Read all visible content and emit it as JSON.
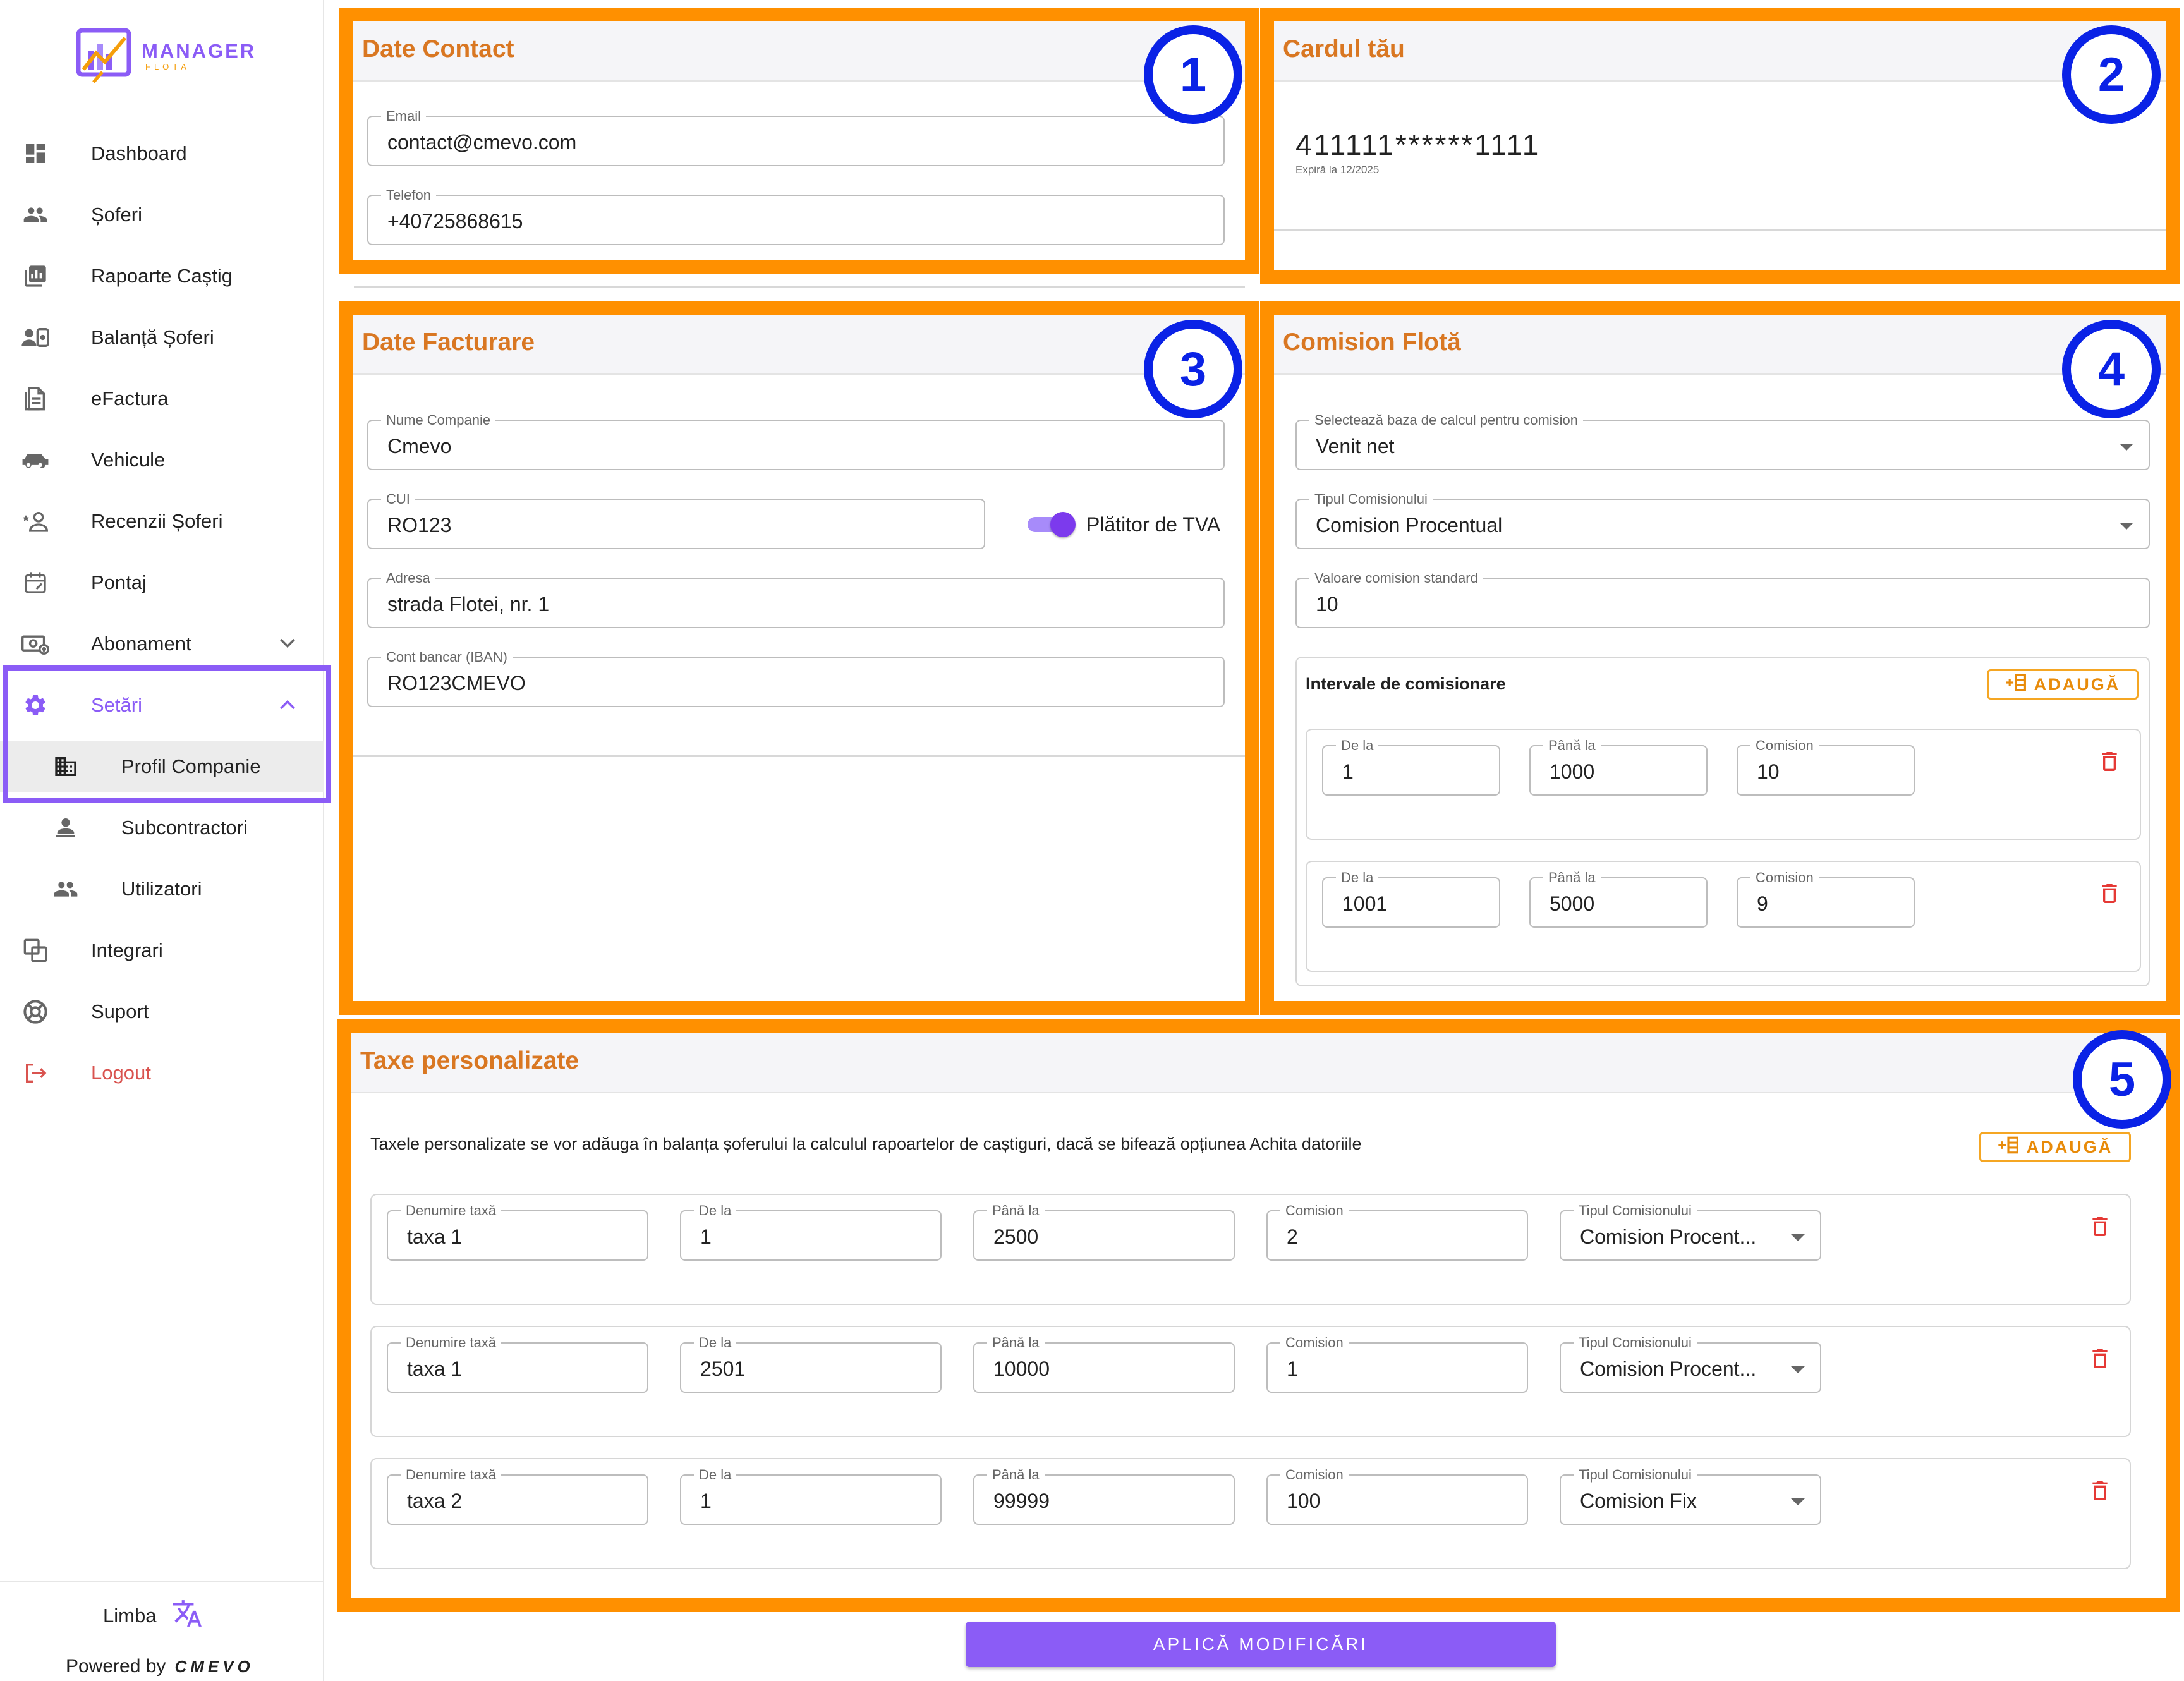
{
  "app": {
    "logo_line1": "MANAGER",
    "logo_line2": "FLOTA"
  },
  "sidebar": {
    "items": [
      {
        "label": "Dashboard",
        "icon": "dashboard-icon"
      },
      {
        "label": "Șoferi",
        "icon": "drivers-icon"
      },
      {
        "label": "Rapoarte Caștig",
        "icon": "reports-icon"
      },
      {
        "label": "Balanță Șoferi",
        "icon": "balance-icon"
      },
      {
        "label": "eFactura",
        "icon": "invoice-icon"
      },
      {
        "label": "Vehicule",
        "icon": "vehicle-icon"
      },
      {
        "label": "Recenzii Șoferi",
        "icon": "reviews-icon"
      },
      {
        "label": "Pontaj",
        "icon": "timesheet-icon"
      },
      {
        "label": "Abonament",
        "icon": "subscription-icon"
      },
      {
        "label": "Setări",
        "icon": "gear-icon"
      },
      {
        "label": "Profil Companie",
        "icon": "building-icon"
      },
      {
        "label": "Subcontractori",
        "icon": "subcontractor-icon"
      },
      {
        "label": "Utilizatori",
        "icon": "users-icon"
      },
      {
        "label": "Integrari",
        "icon": "integrations-icon"
      },
      {
        "label": "Suport",
        "icon": "support-icon"
      },
      {
        "label": "Logout",
        "icon": "logout-icon"
      }
    ],
    "language_label": "Limba",
    "powered_by": "Powered by",
    "powered_brand": "CMEVO"
  },
  "contact": {
    "title": "Date Contact",
    "badge": "1",
    "email_label": "Email",
    "email": "contact@cmevo.com",
    "phone_label": "Telefon",
    "phone": "+40725868615"
  },
  "card": {
    "title": "Cardul tău",
    "badge": "2",
    "number": "411111******1111",
    "expiry": "Expiră la 12/2025"
  },
  "billing": {
    "title": "Date Facturare",
    "badge": "3",
    "company_label": "Nume Companie",
    "company": "Cmevo",
    "cui_label": "CUI",
    "cui": "RO123",
    "vat_label": "Plătitor de TVA",
    "vat_on": true,
    "address_label": "Adresa",
    "address": "strada Flotei, nr. 1",
    "iban_label": "Cont bancar (IBAN)",
    "iban": "RO123CMEVO"
  },
  "commission": {
    "title": "Comision Flotă",
    "badge": "4",
    "base_label": "Selectează baza de calcul pentru comision",
    "base": "Venit net",
    "type_label": "Tipul Comisionului",
    "type": "Comision Procentual",
    "standard_label": "Valoare comision standard",
    "standard": "10",
    "intervals_title": "Intervale de comisionare",
    "add_label": "ADAUGĂ",
    "from_label": "De la",
    "to_label": "Până la",
    "value_label": "Comision",
    "intervals": [
      {
        "from": "1",
        "to": "1000",
        "value": "10"
      },
      {
        "from": "1001",
        "to": "5000",
        "value": "9"
      }
    ]
  },
  "taxes": {
    "title": "Taxe personalizate",
    "badge": "5",
    "description": "Taxele personalizate se vor adăuga în balanța șoferului la calculul rapoartelor de caștiguri, dacă se bifează opțiunea Achita datoriile",
    "add_label": "ADAUGĂ",
    "name_label": "Denumire taxă",
    "from_label": "De la",
    "to_label": "Până la",
    "value_label": "Comision",
    "type_label": "Tipul Comisionului",
    "rows": [
      {
        "name": "taxa 1",
        "from": "1",
        "to": "2500",
        "value": "2",
        "type": "Comision Procent..."
      },
      {
        "name": "taxa 1",
        "from": "2501",
        "to": "10000",
        "value": "1",
        "type": "Comision Procent..."
      },
      {
        "name": "taxa 2",
        "from": "1",
        "to": "99999",
        "value": "100",
        "type": "Comision Fix"
      }
    ]
  },
  "apply_label": "APLICĂ MODIFICĂRI",
  "colors": {
    "accent": "#8b5cf6",
    "highlight": "#ff9000",
    "badge": "#0a22e6",
    "title": "#d97722",
    "danger": "#e53935"
  }
}
